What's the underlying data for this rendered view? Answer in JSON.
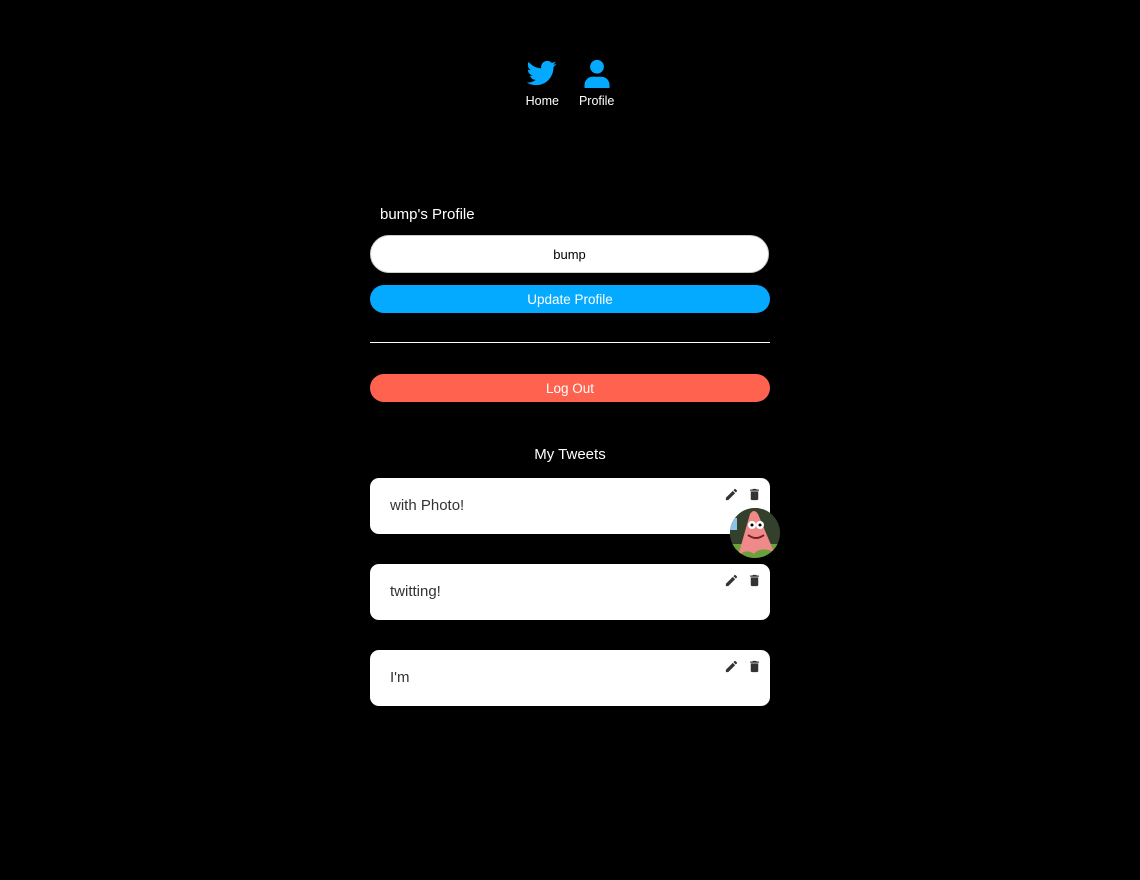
{
  "nav": {
    "home_label": "Home",
    "profile_label": "Profile",
    "home_icon": "twitter-bird-icon",
    "profile_icon": "user-icon",
    "accent": "#04AAFF"
  },
  "profile": {
    "title": "bump's Profile",
    "name_value": "bump",
    "update_label": "Update Profile",
    "logout_label": "Log Out",
    "update_color": "#04AAFF",
    "logout_color": "#FF634F"
  },
  "tweets": {
    "title": "My Tweets",
    "items": [
      {
        "text": "with Photo!",
        "has_photo": true
      },
      {
        "text": "twitting!",
        "has_photo": false
      },
      {
        "text": "I'm",
        "has_photo": false
      }
    ],
    "edit_icon": "pencil-icon",
    "delete_icon": "trash-icon"
  }
}
